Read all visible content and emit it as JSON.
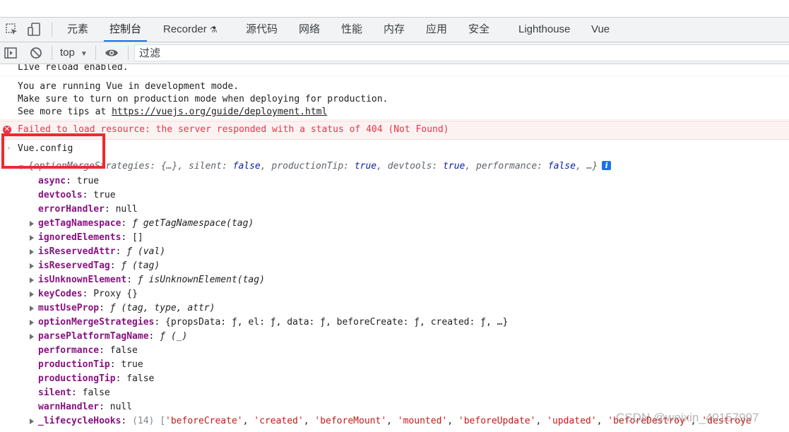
{
  "tabs": [
    {
      "label": "元素"
    },
    {
      "label": "控制台",
      "active": true
    },
    {
      "label": "Recorder"
    },
    {
      "label": "源代码"
    },
    {
      "label": "网络"
    },
    {
      "label": "性能"
    },
    {
      "label": "内存"
    },
    {
      "label": "应用"
    },
    {
      "label": "安全"
    },
    {
      "label": "Lighthouse"
    },
    {
      "label": "Vue"
    }
  ],
  "toolbar": {
    "context": "top",
    "filter_placeholder": "过滤"
  },
  "messages": {
    "live_reload": "Live reload enabled.",
    "vue_dev_1": "You are running Vue in development mode.",
    "vue_dev_2": "Make sure to turn on production mode when deploying for production.",
    "vue_dev_3_prefix": "See more tips at ",
    "vue_dev_link": "https://vuejs.org/guide/deployment.html",
    "error_text": "Failed to load resource: the server responded with a status of 404 (Not Found)",
    "expression": "Vue.config"
  },
  "object_summary": {
    "open": "{",
    "p1_key": "optionMergeStrategies",
    "p1_val": "{…}",
    "p2_key": "silent",
    "p2_val": "false",
    "p3_key": "productionTip",
    "p3_val": "true",
    "p4_key": "devtools",
    "p4_val": "true",
    "p5_key": "performance",
    "p5_val": "false",
    "close": "…}"
  },
  "properties": [
    {
      "name": "async",
      "value": "true",
      "kind": "kw",
      "expandable": false
    },
    {
      "name": "devtools",
      "value": "true",
      "kind": "kw",
      "expandable": false
    },
    {
      "name": "errorHandler",
      "value": "null",
      "kind": "nul",
      "expandable": false
    },
    {
      "name": "getTagNamespace",
      "value": "ƒ getTagNamespace(tag)",
      "kind": "fn",
      "expandable": true
    },
    {
      "name": "ignoredElements",
      "value": "[]",
      "kind": "plain",
      "expandable": true
    },
    {
      "name": "isReservedAttr",
      "value": "ƒ (val)",
      "kind": "fn",
      "expandable": true
    },
    {
      "name": "isReservedTag",
      "value": "ƒ (tag)",
      "kind": "fn",
      "expandable": true
    },
    {
      "name": "isUnknownElement",
      "value": "ƒ isUnknownElement(tag)",
      "kind": "fn",
      "expandable": true
    },
    {
      "name": "keyCodes",
      "value": "Proxy {}",
      "kind": "proxy",
      "expandable": true
    },
    {
      "name": "mustUseProp",
      "value": "ƒ (tag, type, attr)",
      "kind": "fn",
      "expandable": true
    },
    {
      "name": "optionMergeStrategies",
      "value": "{propsData: ƒ, el: ƒ, data: ƒ, beforeCreate: ƒ, created: ƒ, …}",
      "kind": "plain",
      "expandable": true
    },
    {
      "name": "parsePlatformTagName",
      "value": "ƒ (_)",
      "kind": "fn",
      "expandable": true
    },
    {
      "name": "performance",
      "value": "false",
      "kind": "kw",
      "expandable": false
    },
    {
      "name": "productionTip",
      "value": "true",
      "kind": "kw",
      "expandable": false
    },
    {
      "name": "productiongTip",
      "value": "false",
      "kind": "kw",
      "expandable": false
    },
    {
      "name": "silent",
      "value": "false",
      "kind": "kw",
      "expandable": false
    },
    {
      "name": "warnHandler",
      "value": "null",
      "kind": "nul",
      "expandable": false
    },
    {
      "name": "_lifecycleHooks",
      "value": "(14) ['beforeCreate', 'created', 'beforeMount', 'mounted', 'beforeUpdate', 'updated', 'beforeDestroy', 'destroye",
      "kind": "arr",
      "expandable": true
    }
  ],
  "watermark": "CSDN @weixin_40157997",
  "colors": {
    "accent": "#1a73e8",
    "error": "#e8364b",
    "property_name": "#881280",
    "keyword": "#0d22aa",
    "highlight_box": "#ee2b2b"
  }
}
